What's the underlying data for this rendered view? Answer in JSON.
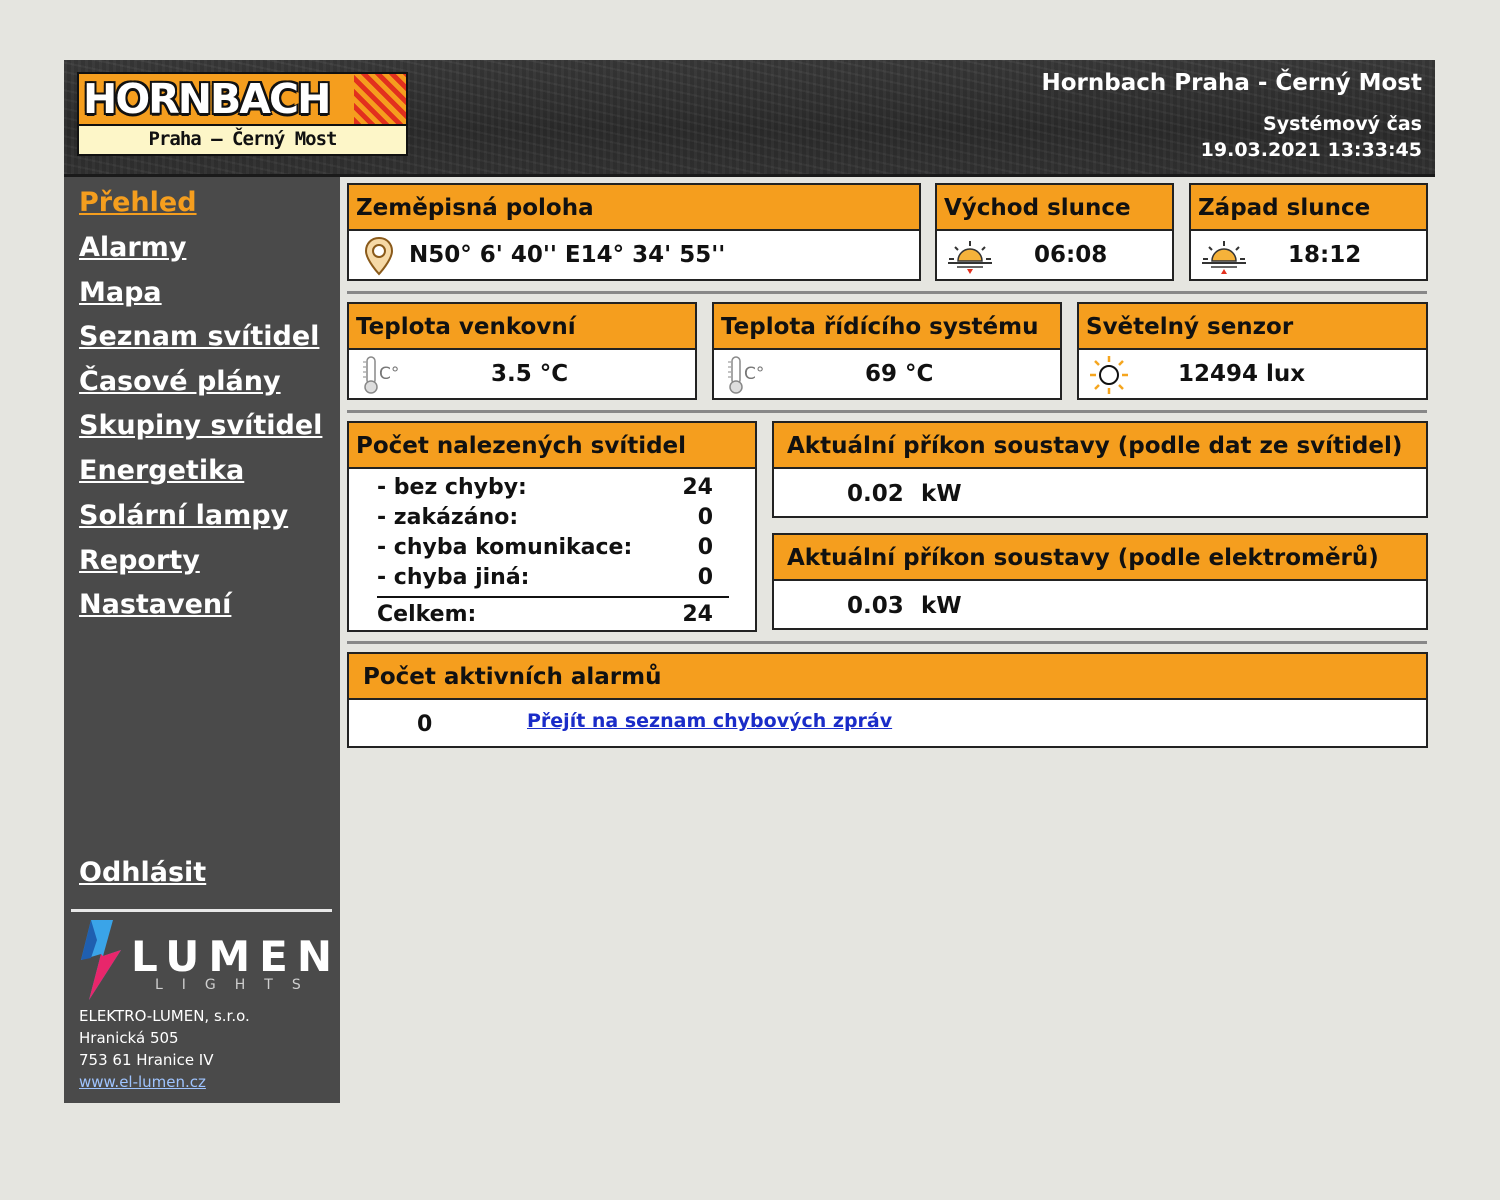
{
  "header": {
    "logo_brand": "HORNBACH",
    "logo_location": "Praha – Černý Most",
    "site_title": "Hornbach Praha - Černý Most",
    "system_time_label": "Systémový čas",
    "system_time": "19.03.2021 13:33:45"
  },
  "sidebar": {
    "items": [
      {
        "label": "Přehled",
        "active": true
      },
      {
        "label": "Alarmy"
      },
      {
        "label": "Mapa"
      },
      {
        "label": "Seznam svítidel"
      },
      {
        "label": "Časové plány"
      },
      {
        "label": "Skupiny svítidel"
      },
      {
        "label": "Energetika"
      },
      {
        "label": "Solární lampy"
      },
      {
        "label": "Reporty"
      },
      {
        "label": "Nastavení"
      }
    ],
    "logout": "Odhlásit",
    "company_logo": {
      "word": "LUMEN",
      "sub": "LIGHTS"
    },
    "address": {
      "company": "ELEKTRO-LUMEN, s.r.o.",
      "street": "Hranická 505",
      "city": "753 61 Hranice IV",
      "web": "www.el-lumen.cz"
    }
  },
  "panels": {
    "location": {
      "title": "Zeměpisná poloha",
      "value": "N50° 6' 40'' E14° 34' 55''",
      "icon": "map-pin-icon"
    },
    "sunrise": {
      "title": "Východ slunce",
      "value": "06:08",
      "icon": "sunrise-icon"
    },
    "sunset": {
      "title": "Západ slunce",
      "value": "18:12",
      "icon": "sunset-icon"
    },
    "temp_outdoor": {
      "title": "Teplota venkovní",
      "value": "3.5 °C",
      "icon": "thermometer-icon"
    },
    "temp_system": {
      "title": "Teplota řídícího systému",
      "value": "69 °C",
      "icon": "thermometer-icon"
    },
    "light_sensor": {
      "title": "Světelný senzor",
      "value": "12494 lux",
      "icon": "sun-icon"
    },
    "lamps_found": {
      "title": "Počet nalezených svítidel",
      "rows": [
        {
          "label": "- bez chyby:",
          "value": "24"
        },
        {
          "label": "- zakázáno:",
          "value": "0"
        },
        {
          "label": "- chyba komunikace:",
          "value": "0"
        },
        {
          "label": "- chyba jiná:",
          "value": "0"
        }
      ],
      "total_label": "Celkem:",
      "total_value": "24"
    },
    "power_lamps": {
      "title": "Aktuální příkon soustavy (podle dat ze svítidel)",
      "value": "0.02",
      "unit": "kW"
    },
    "power_meters": {
      "title": "Aktuální příkon soustavy (podle elektroměrů)",
      "value": "0.03",
      "unit": "kW"
    },
    "alarms": {
      "title": "Počet aktivních alarmů",
      "value": "0",
      "link": "Přejít na seznam chybových zpráv"
    }
  },
  "colors": {
    "accent": "#f59e1e",
    "sidebar_bg": "#4a4a4a",
    "page_bg": "#e5e5e0",
    "link": "#1a2cc8"
  }
}
